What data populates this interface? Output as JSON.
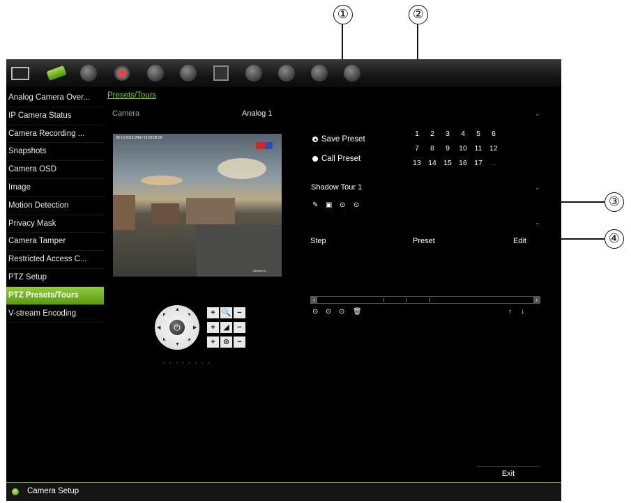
{
  "callouts": [
    "①",
    "②",
    "③",
    "④"
  ],
  "top_icons": [
    "monitor-icon",
    "camera-icon",
    "network-icon",
    "record-icon",
    "alarm-icon",
    "hdd-icon",
    "schedule-icon",
    "user-icon",
    "system-icon",
    "disk-icon",
    "device-icon"
  ],
  "sidebar": {
    "items": [
      {
        "label": "Analog Camera Over...",
        "active": false
      },
      {
        "label": "IP Camera Status",
        "active": false
      },
      {
        "label": "Camera Recording ...",
        "active": false
      },
      {
        "label": "Snapshots",
        "active": false
      },
      {
        "label": "Camera OSD",
        "active": false
      },
      {
        "label": "Image",
        "active": false
      },
      {
        "label": "Motion Detection",
        "active": false
      },
      {
        "label": "Privacy Mask",
        "active": false
      },
      {
        "label": "Camera Tamper",
        "active": false
      },
      {
        "label": "Restricted Access C...",
        "active": false
      },
      {
        "label": "PTZ Setup",
        "active": false
      },
      {
        "label": "PTZ Presets/Tours",
        "active": true
      },
      {
        "label": "V-stream Encoding",
        "active": false
      }
    ]
  },
  "header": {
    "breadcrumb": "Presets/Tours"
  },
  "camera": {
    "label": "Camera",
    "value": "Analog 1"
  },
  "video": {
    "timestamp": "08-13-2015 WED 10:08:08.28",
    "name": "Camera 01"
  },
  "presets": {
    "save_label": "Save Preset",
    "call_label": "Call Preset",
    "numbers": [
      "1",
      "2",
      "3",
      "4",
      "5",
      "6",
      "7",
      "8",
      "9",
      "10",
      "11",
      "12",
      "13",
      "14",
      "15",
      "16",
      "17",
      "..."
    ]
  },
  "tour": {
    "name": "Shadow Tour 1"
  },
  "table": {
    "columns": [
      "Step",
      "Preset",
      "Edit"
    ]
  },
  "buttons": {
    "exit": "Exit"
  },
  "status": {
    "text": "Camera Setup"
  },
  "colors": {
    "accent": "#7ed321",
    "active_bg": "#6aaa1f",
    "background": "#000000"
  }
}
